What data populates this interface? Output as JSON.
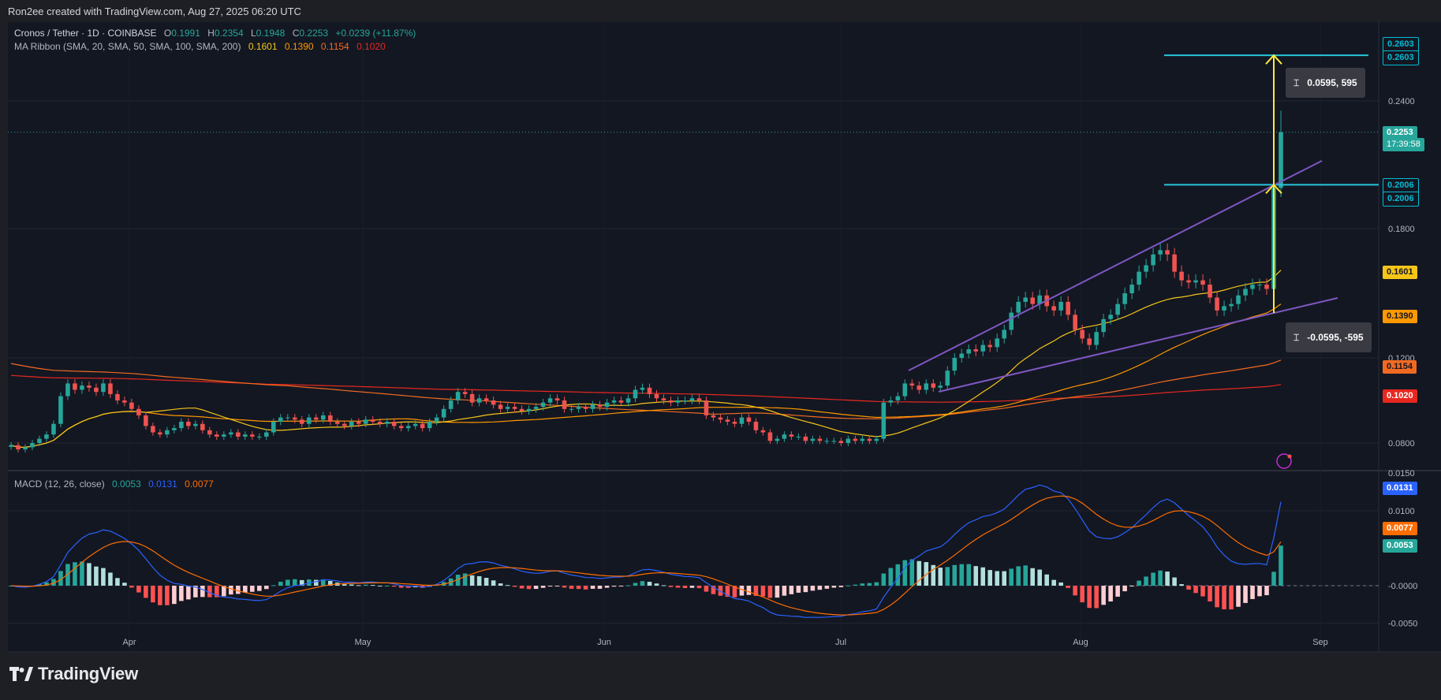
{
  "header": {
    "attribution": "Ron2ee created with TradingView.com, Aug 27, 2025 06:20 UTC"
  },
  "symbol": {
    "name": "Cronos / Tether · 1D · COINBASE",
    "open_label": "O",
    "open": "0.1991",
    "high_label": "H",
    "high": "0.2354",
    "low_label": "L",
    "low": "0.1948",
    "close_label": "C",
    "close": "0.2253",
    "change": "+0.0239 (+11.87%)"
  },
  "ma_ribbon": {
    "label": "MA Ribbon (SMA, 20, SMA, 50, SMA, 100, SMA, 200)",
    "values": [
      "0.1601",
      "0.1390",
      "0.1154",
      "0.1020"
    ],
    "colors": [
      "#f5c518",
      "#ff9800",
      "#f26a21",
      "#e8281f"
    ]
  },
  "macd": {
    "label": "MACD (12, 26, close)",
    "values": [
      "0.0053",
      "0.0131",
      "0.0077"
    ],
    "colors": [
      "#26a69a",
      "#2962ff",
      "#ff6d00"
    ]
  },
  "price_axis": {
    "ticks": [
      "0.2400",
      "0.1800",
      "0.1200",
      "0.0800"
    ],
    "partial_tick": "0.0150"
  },
  "macd_axis": {
    "ticks": [
      "0.0100",
      "-0.0000",
      "-0.0050"
    ]
  },
  "time_axis": {
    "ticks": [
      "Apr",
      "May",
      "Jun",
      "Jul",
      "Aug",
      "Sep"
    ]
  },
  "price_tags": {
    "target_top": "0.2603",
    "target_bottom": "0.2603",
    "last_price": "0.2253",
    "countdown": "17:39:58",
    "level_top": "0.2006",
    "level_bottom": "0.2006",
    "sma20": "0.1601",
    "sma50": "0.1390",
    "sma100": "0.1154",
    "sma200": "0.1020"
  },
  "macd_tags": {
    "macd": "0.0131",
    "signal": "0.0077",
    "hist": "0.0053"
  },
  "measure": {
    "up": "0.0595, 595",
    "down": "-0.0595, -595"
  },
  "logo": {
    "text": "TradingView"
  },
  "chart_data": {
    "type": "candlestick",
    "symbol": "Cronos / Tether",
    "interval": "1D",
    "exchange": "COINBASE",
    "last_candle": {
      "open": 0.1991,
      "high": 0.2354,
      "low": 0.1948,
      "close": 0.2253
    },
    "series": [
      {
        "name": "Price",
        "values": [
          0.079,
          0.077,
          0.078,
          0.08,
          0.082,
          0.084,
          0.089,
          0.102,
          0.108,
          0.105,
          0.107,
          0.106,
          0.104,
          0.108,
          0.103,
          0.1,
          0.099,
          0.096,
          0.093,
          0.088,
          0.085,
          0.084,
          0.086,
          0.087,
          0.09,
          0.088,
          0.089,
          0.086,
          0.084,
          0.083,
          0.084,
          0.085,
          0.083,
          0.084,
          0.083,
          0.083,
          0.085,
          0.09,
          0.092,
          0.092,
          0.091,
          0.089,
          0.092,
          0.091,
          0.093,
          0.09,
          0.089,
          0.088,
          0.09,
          0.089,
          0.091,
          0.09,
          0.089,
          0.09,
          0.088,
          0.087,
          0.088,
          0.089,
          0.087,
          0.09,
          0.092,
          0.096,
          0.1,
          0.104,
          0.103,
          0.099,
          0.101,
          0.1,
          0.098,
          0.096,
          0.097,
          0.096,
          0.095,
          0.096,
          0.097,
          0.099,
          0.101,
          0.1,
          0.096,
          0.096,
          0.097,
          0.096,
          0.098,
          0.097,
          0.099,
          0.1,
          0.099,
          0.101,
          0.105,
          0.106,
          0.103,
          0.101,
          0.1,
          0.099,
          0.1,
          0.1,
          0.101,
          0.1,
          0.093,
          0.092,
          0.091,
          0.09,
          0.089,
          0.092,
          0.09,
          0.086,
          0.085,
          0.081,
          0.082,
          0.084,
          0.083,
          0.083,
          0.081,
          0.082,
          0.081,
          0.081,
          0.081,
          0.08,
          0.082,
          0.081,
          0.082,
          0.081,
          0.082,
          0.099,
          0.1,
          0.102,
          0.108,
          0.107,
          0.105,
          0.108,
          0.106,
          0.107,
          0.114,
          0.12,
          0.122,
          0.124,
          0.123,
          0.126,
          0.125,
          0.129,
          0.133,
          0.141,
          0.146,
          0.148,
          0.145,
          0.149,
          0.144,
          0.142,
          0.146,
          0.14,
          0.133,
          0.129,
          0.126,
          0.132,
          0.138,
          0.14,
          0.145,
          0.15,
          0.154,
          0.16,
          0.163,
          0.168,
          0.17,
          0.168,
          0.16,
          0.156,
          0.155,
          0.156,
          0.154,
          0.148,
          0.142,
          0.144,
          0.145,
          0.149,
          0.152,
          0.154,
          0.154,
          0.152,
          0.1991,
          0.2253
        ]
      },
      {
        "name": "SMA 20",
        "current": 0.1601
      },
      {
        "name": "SMA 50",
        "current": 0.139
      },
      {
        "name": "SMA 100",
        "current": 0.1154
      },
      {
        "name": "SMA 200",
        "current": 0.102
      },
      {
        "name": "MACD",
        "current": 0.0131
      },
      {
        "name": "Signal",
        "current": 0.0077
      },
      {
        "name": "Histogram",
        "current": 0.0053
      }
    ],
    "drawings": {
      "horizontal_levels": [
        0.2603,
        0.2006
      ],
      "measure_up": {
        "from": 0.1408,
        "to": 0.2003,
        "delta": "0.0595, 595"
      },
      "measure_down": {
        "from": 0.2603,
        "to": 0.2006,
        "delta": "-0.0595, -595"
      },
      "channel": "rising wedge (purple)"
    },
    "y_axis": {
      "min": 0.065,
      "max": 0.265,
      "ticks": [
        0.24,
        0.18,
        0.12,
        0.08
      ]
    },
    "macd_axis": {
      "ticks": [
        0.01,
        0.0,
        -0.005
      ]
    },
    "x_axis": {
      "ticks": [
        "Apr",
        "May",
        "Jun",
        "Jul",
        "Aug",
        "Sep"
      ]
    },
    "grid": true,
    "legend_placement": "top-left"
  }
}
